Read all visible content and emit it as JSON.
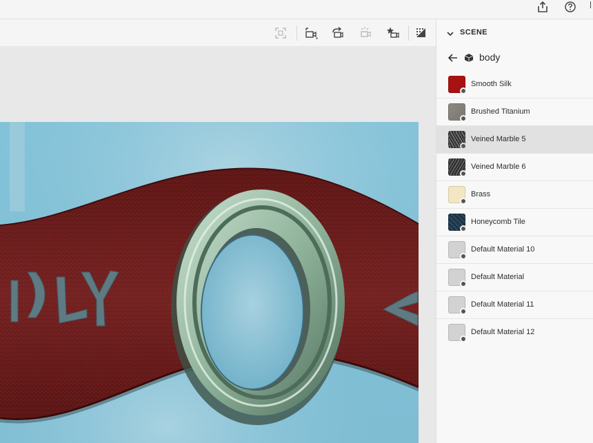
{
  "top_bar": {
    "icons": [
      "share-icon",
      "help-icon"
    ]
  },
  "toolbar": {
    "icons": [
      "frame-selection-icon",
      "camera-options-icon",
      "rotate-view-icon",
      "light-options-icon",
      "starred-object-icon",
      "render-preview-icon"
    ]
  },
  "panel": {
    "section_title": "SCENE",
    "breadcrumb_label": "body",
    "materials": [
      {
        "label": "Smooth Silk",
        "swatch": "#a81212"
      },
      {
        "label": "Brushed Titanium",
        "swatch": "#8a857f"
      },
      {
        "label": "Veined Marble 5",
        "swatch": "#3a3a3a"
      },
      {
        "label": "Veined Marble 6",
        "swatch": "#343434"
      },
      {
        "label": "Brass",
        "swatch": "#f3e6c2"
      },
      {
        "label": "Honeycomb Tile",
        "swatch": "#203545"
      },
      {
        "label": "Default Material 10",
        "swatch": "#d2d2d2"
      },
      {
        "label": "Default Material",
        "swatch": "#d2d2d2"
      },
      {
        "label": "Default Material 11",
        "swatch": "#d2d2d2"
      },
      {
        "label": "Default Material 12",
        "swatch": "#d2d2d2"
      }
    ],
    "selected_index": 2
  },
  "viewport": {
    "scene_text": "ADLY"
  },
  "colors": {
    "background_blue": "#86c3d9",
    "band_red": "#6e2020",
    "ring_green": "#a8c7b3"
  }
}
